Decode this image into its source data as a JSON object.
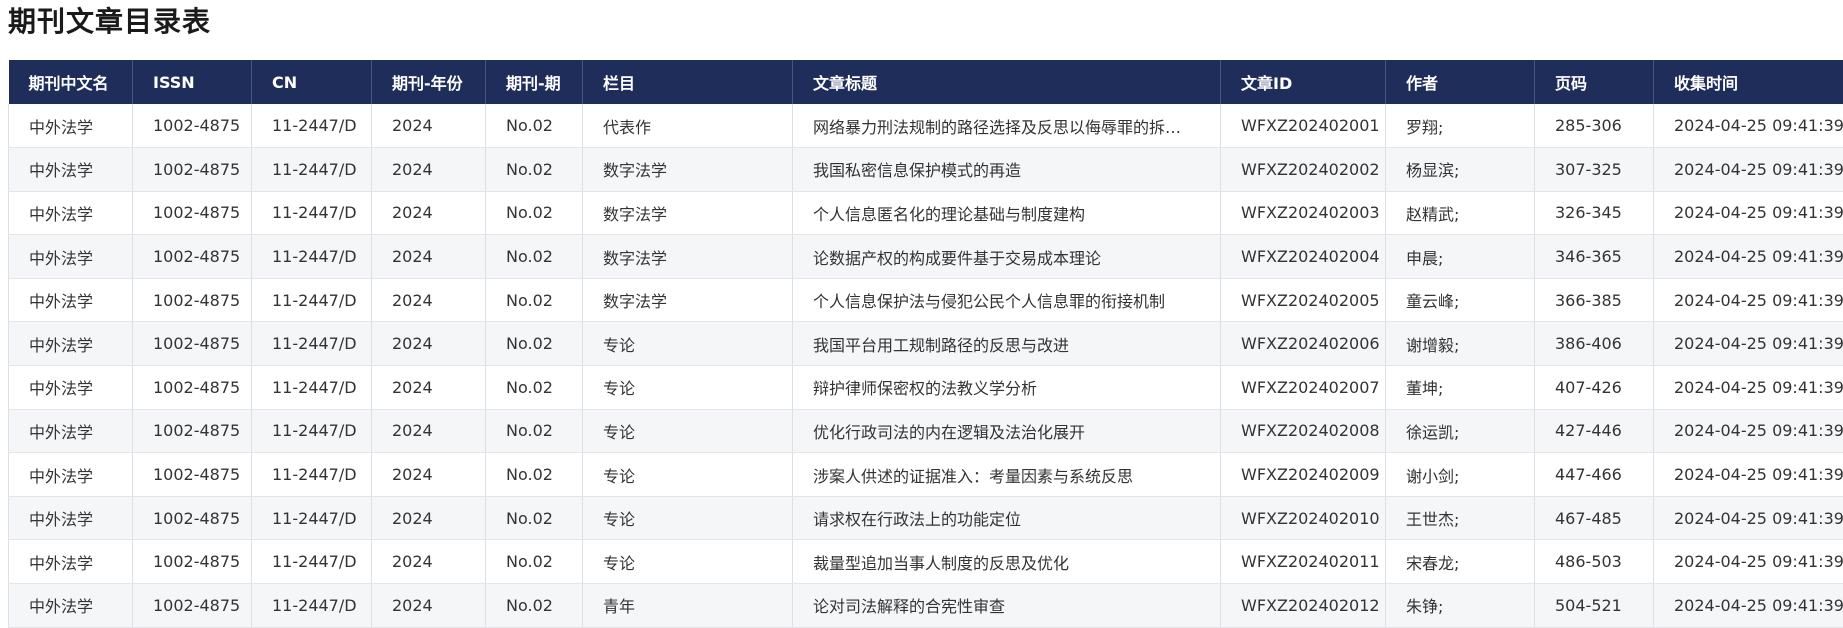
{
  "page": {
    "title": "期刊文章目录表"
  },
  "table": {
    "columns": [
      "期刊中文名",
      "ISSN",
      "CN",
      "期刊-年份",
      "期刊-期",
      "栏目",
      "文章标题",
      "文章ID",
      "作者",
      "页码",
      "收集时间"
    ],
    "rows": [
      [
        "中外法学",
        "1002-4875",
        "11-2447/D",
        "2024",
        "No.02",
        "代表作",
        "网络暴力刑法规制的路径选择及反思以侮辱罪的拆…",
        "WFXZ202402001",
        "罗翔;",
        "285-306",
        "2024-04-25 09:41:39"
      ],
      [
        "中外法学",
        "1002-4875",
        "11-2447/D",
        "2024",
        "No.02",
        "数字法学",
        "我国私密信息保护模式的再造",
        "WFXZ202402002",
        "杨显滨;",
        "307-325",
        "2024-04-25 09:41:39"
      ],
      [
        "中外法学",
        "1002-4875",
        "11-2447/D",
        "2024",
        "No.02",
        "数字法学",
        "个人信息匿名化的理论基础与制度建构",
        "WFXZ202402003",
        "赵精武;",
        "326-345",
        "2024-04-25 09:41:39"
      ],
      [
        "中外法学",
        "1002-4875",
        "11-2447/D",
        "2024",
        "No.02",
        "数字法学",
        "论数据产权的构成要件基于交易成本理论",
        "WFXZ202402004",
        "申晨;",
        "346-365",
        "2024-04-25 09:41:39"
      ],
      [
        "中外法学",
        "1002-4875",
        "11-2447/D",
        "2024",
        "No.02",
        "数字法学",
        "个人信息保护法与侵犯公民个人信息罪的衔接机制",
        "WFXZ202402005",
        "童云峰;",
        "366-385",
        "2024-04-25 09:41:39"
      ],
      [
        "中外法学",
        "1002-4875",
        "11-2447/D",
        "2024",
        "No.02",
        "专论",
        "我国平台用工规制路径的反思与改进",
        "WFXZ202402006",
        "谢增毅;",
        "386-406",
        "2024-04-25 09:41:39"
      ],
      [
        "中外法学",
        "1002-4875",
        "11-2447/D",
        "2024",
        "No.02",
        "专论",
        "辩护律师保密权的法教义学分析",
        "WFXZ202402007",
        "董坤;",
        "407-426",
        "2024-04-25 09:41:39"
      ],
      [
        "中外法学",
        "1002-4875",
        "11-2447/D",
        "2024",
        "No.02",
        "专论",
        "优化行政司法的内在逻辑及法治化展开",
        "WFXZ202402008",
        "徐运凯;",
        "427-446",
        "2024-04-25 09:41:39"
      ],
      [
        "中外法学",
        "1002-4875",
        "11-2447/D",
        "2024",
        "No.02",
        "专论",
        "涉案人供述的证据准入：考量因素与系统反思",
        "WFXZ202402009",
        "谢小剑;",
        "447-466",
        "2024-04-25 09:41:39"
      ],
      [
        "中外法学",
        "1002-4875",
        "11-2447/D",
        "2024",
        "No.02",
        "专论",
        "请求权在行政法上的功能定位",
        "WFXZ202402010",
        "王世杰;",
        "467-485",
        "2024-04-25 09:41:39"
      ],
      [
        "中外法学",
        "1002-4875",
        "11-2447/D",
        "2024",
        "No.02",
        "专论",
        "裁量型追加当事人制度的反思及优化",
        "WFXZ202402011",
        "宋春龙;",
        "486-503",
        "2024-04-25 09:41:39"
      ],
      [
        "中外法学",
        "1002-4875",
        "11-2447/D",
        "2024",
        "No.02",
        "青年",
        "论对司法解释的合宪性审查",
        "WFXZ202402012",
        "朱铮;",
        "504-521",
        "2024-04-25 09:41:39"
      ]
    ]
  },
  "colors": {
    "header_bg": "#1f2d5b",
    "header_text": "#ffffff",
    "row_alt_bg": "#f5f6f8"
  }
}
